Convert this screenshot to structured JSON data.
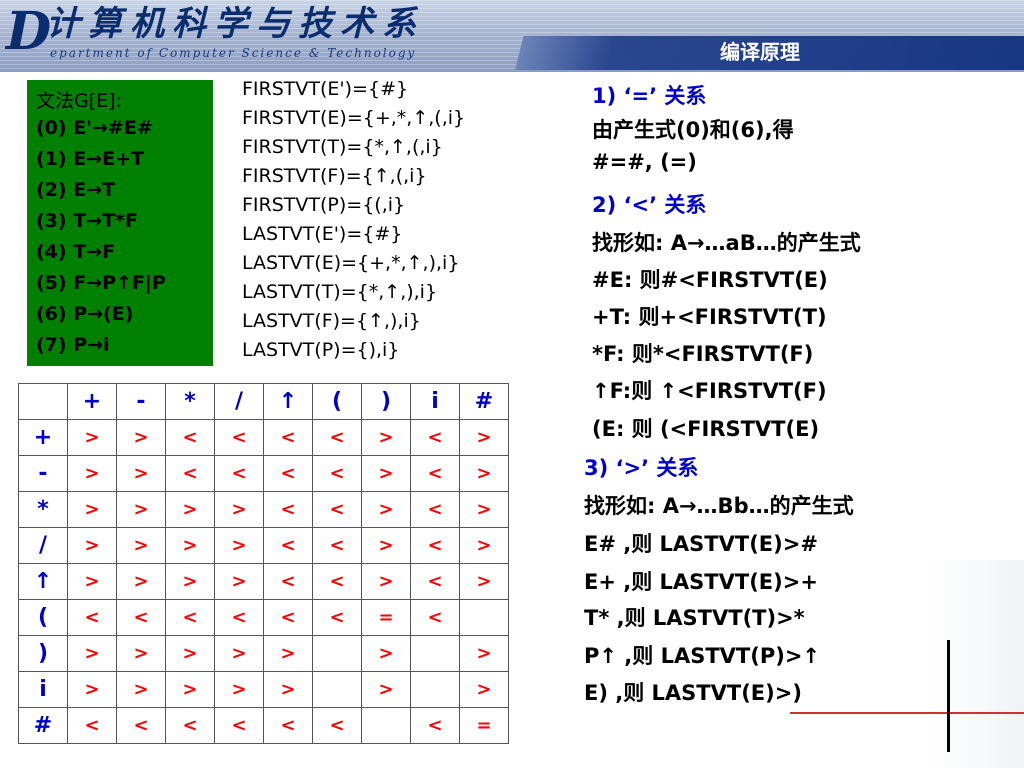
{
  "header": {
    "logo_letter": "D",
    "dept_chinese": "计算机科学与技术系",
    "dept_english": "epartment of Computer Science & Technology",
    "slide_title": "编译原理"
  },
  "grammar": {
    "title": "文法G[E]:",
    "rules": [
      "(0) E'→#E#",
      "(1) E→E+T",
      "(2) E→T",
      "(3) T→T*F",
      "(4) T→F",
      "(5) F→P↑F|P",
      "(6) P→(E)",
      "(7) P→i"
    ]
  },
  "sets": [
    "FIRSTVT(E')={#}",
    "FIRSTVT(E)={+,*,↑,(,i}",
    "FIRSTVT(T)={*,↑,(,i}",
    "FIRSTVT(F)={↑,(,i}",
    "FIRSTVT(P)={(,i}",
    "LASTVT(E')={#}",
    "LASTVT(E)={+,*,↑,),i}",
    "LASTVT(T)={*,↑,),i}",
    "LASTVT(F)={↑,),i}",
    "LASTVT(P)={),i}"
  ],
  "explanation": {
    "lines": [
      {
        "text": "1) ‘=’ 关系",
        "blue": true
      },
      {
        "text": "由产生式(0)和(6),得",
        "blue": false
      },
      {
        "text": "#=#, (=)",
        "blue": false
      },
      {
        "text": "2) ‘<’ 关系",
        "blue": true
      },
      {
        "text": "找形如: A→…aB…的产生式",
        "blue": false
      },
      {
        "text": "#E: 则#<FIRSTVT(E)",
        "blue": false
      },
      {
        "text": "+T: 则+<FIRSTVT(T)",
        "blue": false
      },
      {
        "text": "*F: 则*<FIRSTVT(F)",
        "blue": false
      },
      {
        "text": "↑F:则 ↑<FIRSTVT(F)",
        "blue": false
      },
      {
        "text": "(E: 则 (<FIRSTVT(E)",
        "blue": false
      },
      {
        "text": "3) ‘>’ 关系",
        "blue": true
      },
      {
        "text": "找形如: A→…Bb…的产生式",
        "blue": false
      },
      {
        "text": "E# ,则 LASTVT(E)>#",
        "blue": false
      },
      {
        "text": "E+ ,则 LASTVT(E)>+",
        "blue": false
      },
      {
        "text": "T* ,则 LASTVT(T)>*",
        "blue": false
      },
      {
        "text": "P↑ ,则 LASTVT(P)>↑",
        "blue": false
      },
      {
        "text": "E) ,则 LASTVT(E)>)",
        "blue": false
      }
    ]
  },
  "table": {
    "columns": [
      "+",
      "-",
      "*",
      "/",
      "↑",
      "(",
      ")",
      "i",
      "#"
    ],
    "rows": [
      {
        "head": "+",
        "cells": [
          ">",
          ">",
          "<",
          "<",
          "<",
          "<",
          ">",
          "<",
          ">"
        ]
      },
      {
        "head": "-",
        "cells": [
          ">",
          ">",
          "<",
          "<",
          "<",
          "<",
          ">",
          "<",
          ">"
        ]
      },
      {
        "head": "*",
        "cells": [
          ">",
          ">",
          ">",
          ">",
          "<",
          "<",
          ">",
          "<",
          ">"
        ]
      },
      {
        "head": "/",
        "cells": [
          ">",
          ">",
          ">",
          ">",
          "<",
          "<",
          ">",
          "<",
          ">"
        ]
      },
      {
        "head": "↑",
        "cells": [
          ">",
          ">",
          ">",
          ">",
          "<",
          "<",
          ">",
          "<",
          ">"
        ]
      },
      {
        "head": "(",
        "cells": [
          "<",
          "<",
          "<",
          "<",
          "<",
          "<",
          "=",
          "<",
          ""
        ]
      },
      {
        "head": ")",
        "cells": [
          ">",
          ">",
          ">",
          ">",
          ">",
          "",
          ">",
          "",
          ">"
        ]
      },
      {
        "head": "i",
        "cells": [
          ">",
          ">",
          ">",
          ">",
          ">",
          "",
          ">",
          "",
          ">"
        ]
      },
      {
        "head": "#",
        "cells": [
          "<",
          "<",
          "<",
          "<",
          "<",
          "<",
          "",
          "<",
          "="
        ]
      }
    ]
  }
}
